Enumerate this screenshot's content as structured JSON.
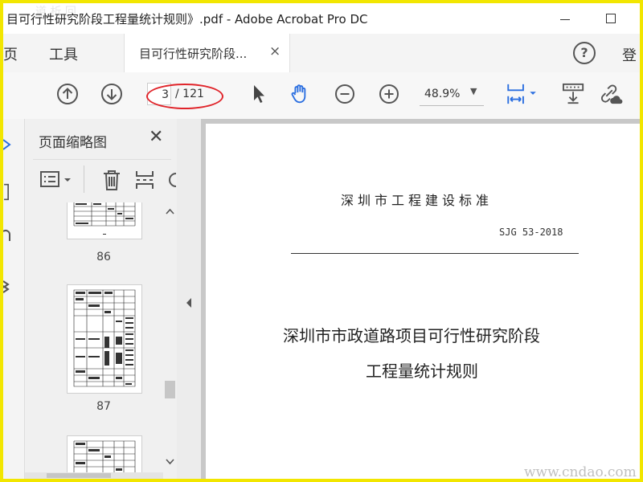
{
  "window": {
    "title": "目可行性研究阶段工程量统计规则》.pdf - Adobe Acrobat Pro DC",
    "corner_watermark": "道 析 回"
  },
  "tabs": {
    "home": "主页",
    "tools": "工具",
    "document": "目可行性研究阶段...",
    "document_close": "×",
    "help": "?",
    "login": "登"
  },
  "toolbar": {
    "page_current": "3",
    "page_total": "/ 121",
    "zoom": "48.9%",
    "zoom_caret": "▼"
  },
  "thumbnails_panel": {
    "title": "页面缩略图",
    "close": "✕",
    "pages": [
      "86",
      "87"
    ]
  },
  "document": {
    "standard_heading": "深圳市工程建设标准",
    "standard_code": "SJG 53-2018",
    "title_line1": "深圳市市政道路项目可行性研究阶段",
    "title_line2": "工程量统计规则",
    "watermark": "www.cndao.com"
  },
  "colors": {
    "frame": "#f2e600",
    "highlight_ellipse": "#e0242a",
    "accent_blue": "#2a6ee0"
  }
}
